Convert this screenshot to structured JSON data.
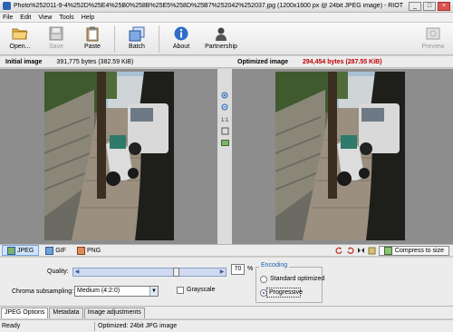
{
  "window": {
    "title": "Photo%252011-9-4%252D%25E4%25B0%258B%25E5%258D%25B7%252042%252037.jpg (1200x1600 px @ 24bit JPEG image) - RIOT",
    "minimize": "_",
    "maximize": "□",
    "close": "×"
  },
  "menu": [
    "File",
    "Edit",
    "View",
    "Tools",
    "Help"
  ],
  "toolbar": {
    "open": "Open...",
    "save": "Save",
    "paste": "Paste",
    "batch": "Batch",
    "about": "About",
    "partnership": "Partnership",
    "preview": "Preview"
  },
  "panels": {
    "initial_title": "Initial image",
    "initial_bytes": "391,775 bytes (382.59 KiB)",
    "optimized_title": "Optimized image",
    "optimized_bytes": "294,454 bytes (287.55 KiB)"
  },
  "format_tabs": [
    "JPEG",
    "GIF",
    "PNG"
  ],
  "compress_button": "Compress to size",
  "settings": {
    "quality_label": "Quality:",
    "quality_value": "70",
    "quality_unit": "%",
    "quality_level": 0.7,
    "chroma_label": "Chroma subsampling:",
    "chroma_value": "Medium (4:2:0)",
    "grayscale_label": "Grayscale",
    "encoding_title": "Encoding",
    "encoding_standard": "Standard optimized",
    "encoding_progressive": "Progressive"
  },
  "bottom_tabs": [
    "JPEG Options",
    "Metadata",
    "Image adjustments"
  ],
  "status": {
    "left": "Ready",
    "right": "Optimized: 24bit JPG image"
  },
  "colors": {
    "accent": "#1f5fb0",
    "red_text": "#c00000"
  }
}
